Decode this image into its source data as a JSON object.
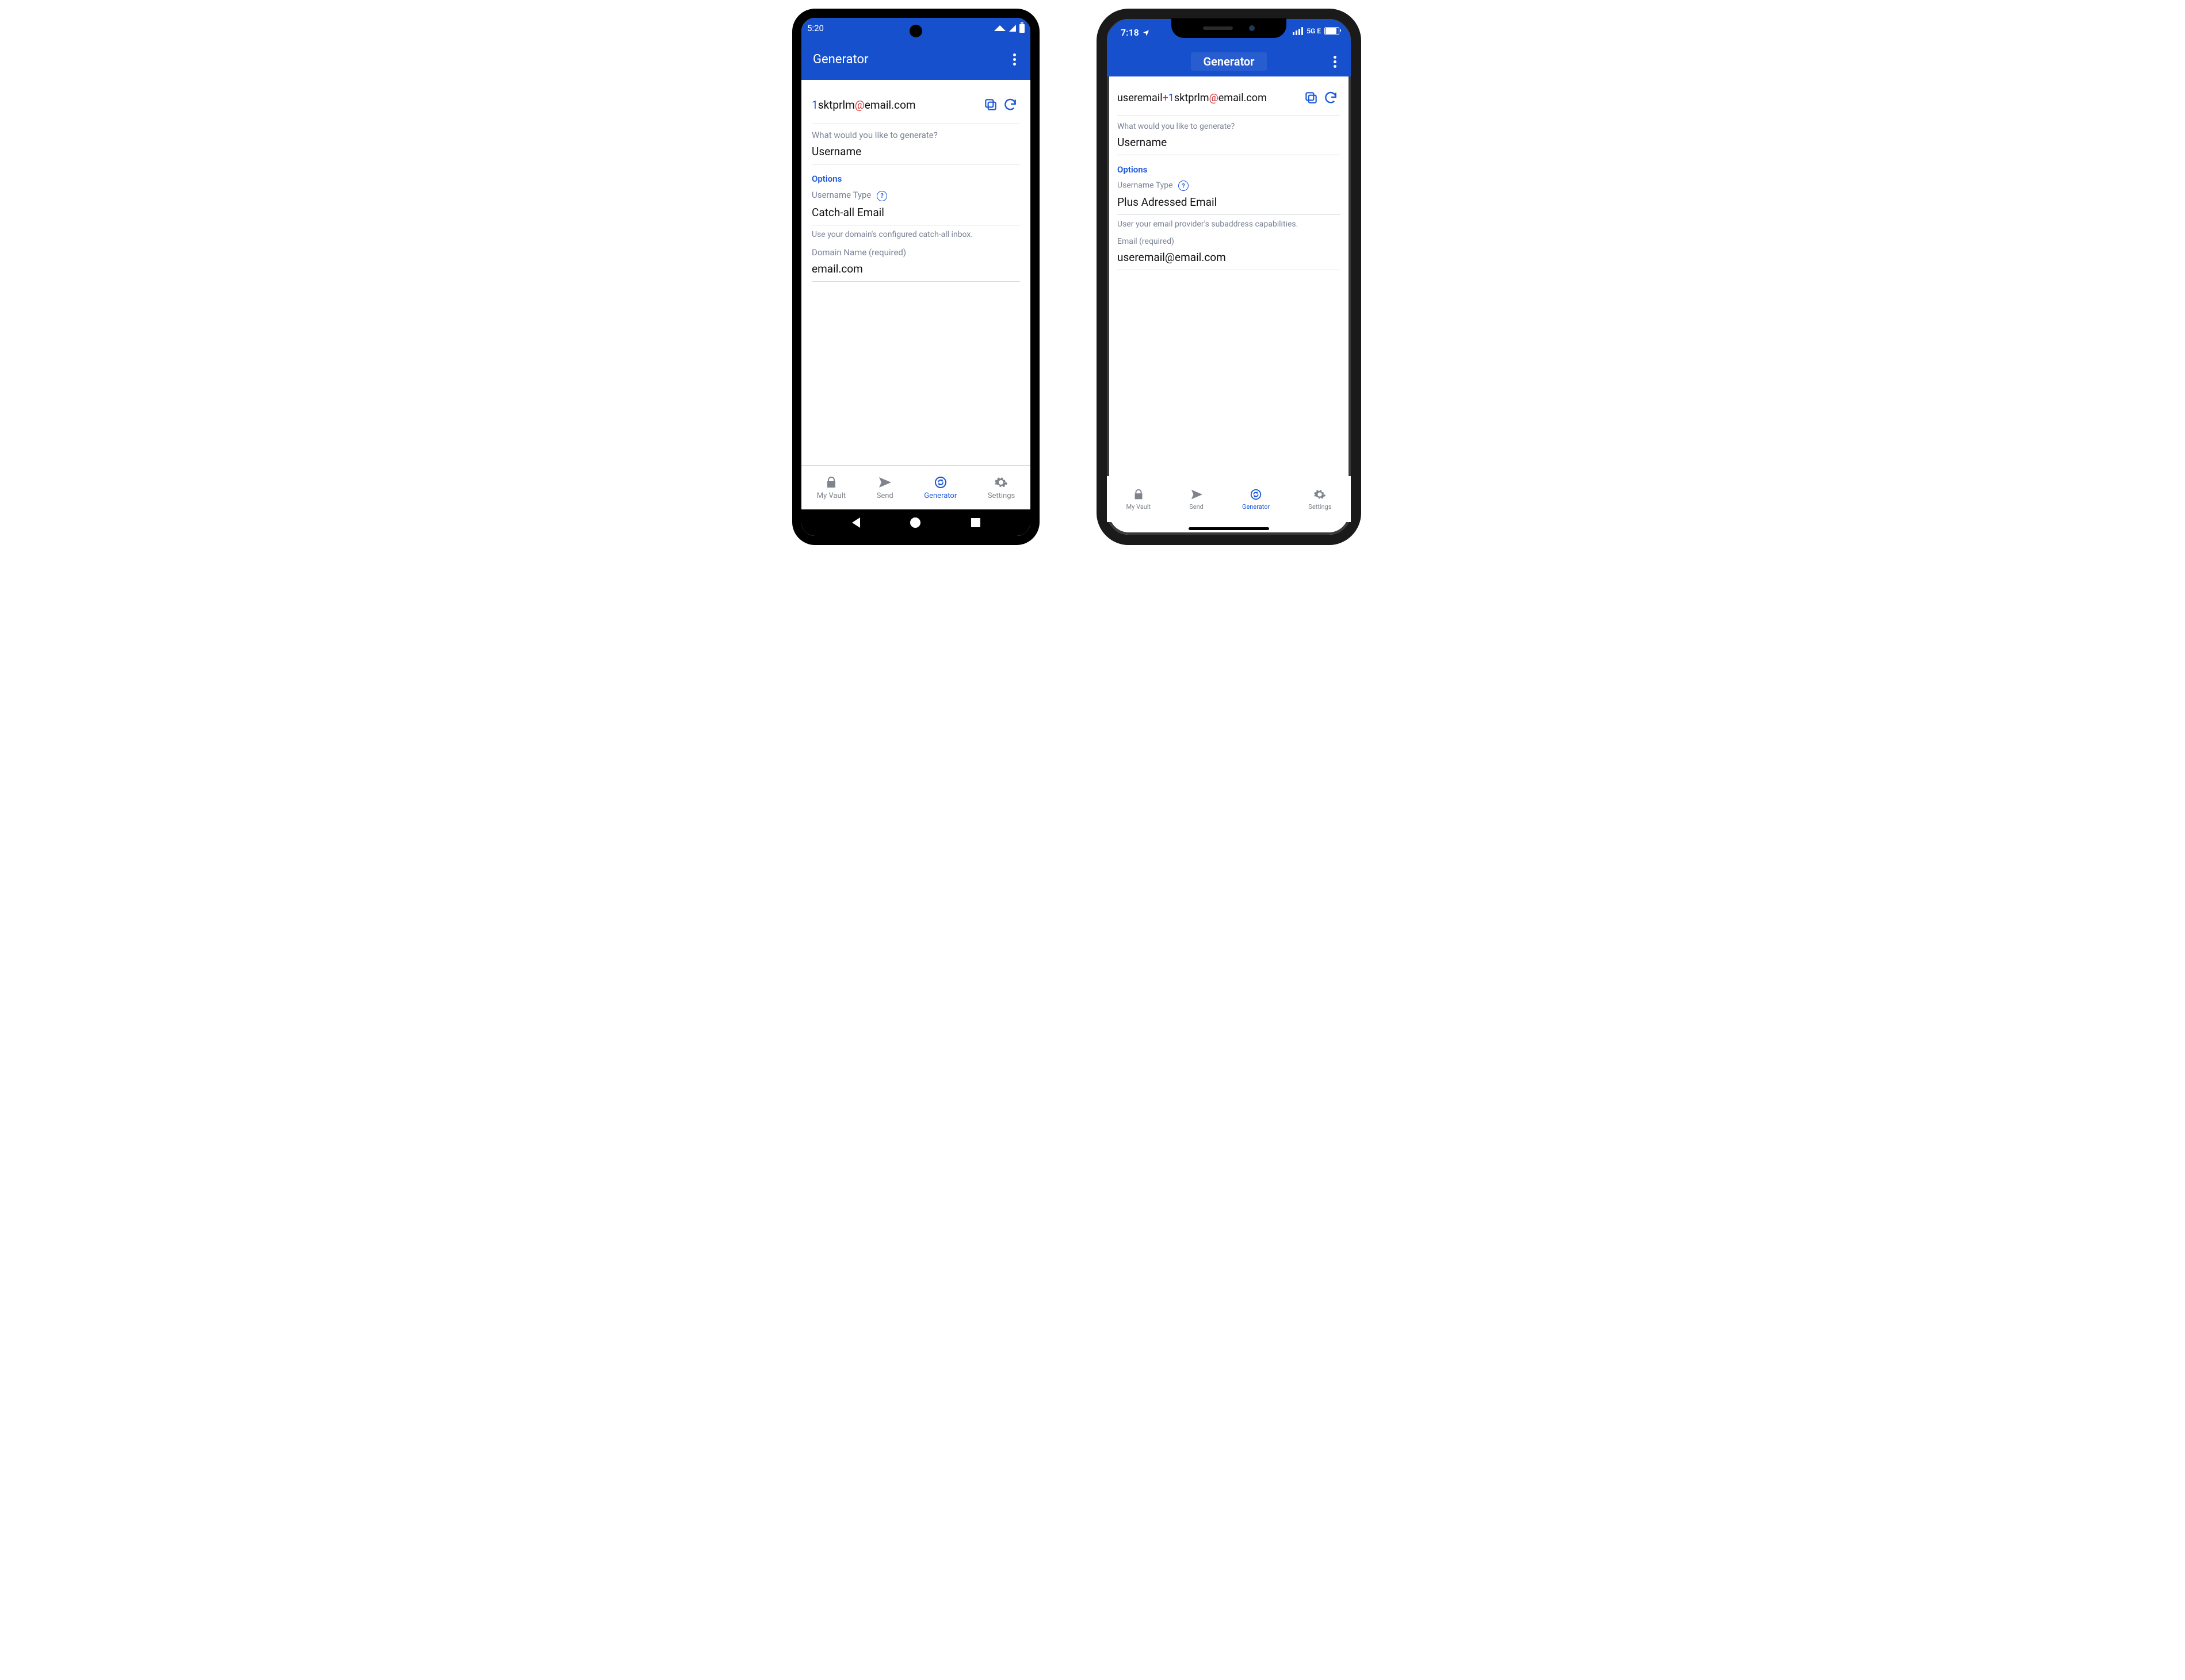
{
  "android": {
    "status": {
      "time": "5:20"
    },
    "appbar": {
      "title": "Generator"
    },
    "generated": {
      "p1": "1",
      "p2": "sktprlm",
      "p3": "@",
      "p4": "email.com"
    },
    "q_label": "What would you like to generate?",
    "q_value": "Username",
    "options_header": "Options",
    "type_label": "Username Type",
    "type_value": "Catch-all Email",
    "type_hint": "Use your domain's configured catch-all inbox.",
    "field_label": "Domain Name (required)",
    "field_value": "email.com"
  },
  "ios": {
    "status": {
      "time": "7:18",
      "net": "5G E"
    },
    "appbar": {
      "title": "Generator"
    },
    "generated": {
      "p1": "useremail",
      "p2": "+",
      "p3": "1",
      "p4": "sktprlm",
      "p5": "@",
      "p6": "email.com"
    },
    "q_label": "What would you like to generate?",
    "q_value": "Username",
    "options_header": "Options",
    "type_label": "Username Type",
    "type_value": "Plus Adressed Email",
    "type_hint": "User your email provider's subaddress capabilities.",
    "field_label": "Email (required)",
    "field_value": "useremail@email.com"
  },
  "nav": {
    "vault": "My Vault",
    "send": "Send",
    "generator": "Generator",
    "settings": "Settings"
  }
}
